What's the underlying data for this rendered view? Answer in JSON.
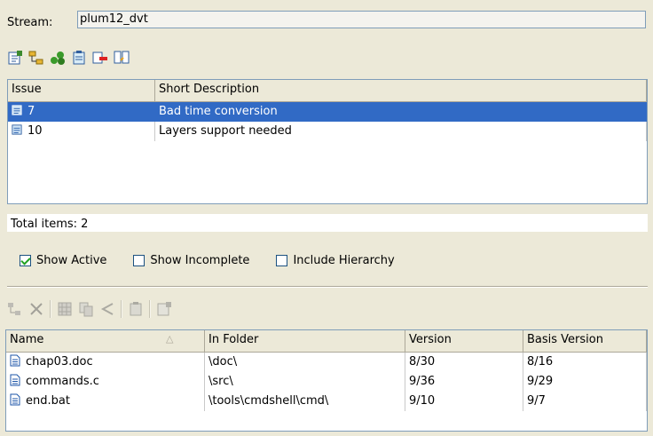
{
  "stream": {
    "label": "Stream:",
    "value": "plum12_dvt"
  },
  "issues": {
    "columns": [
      "Issue",
      "Short Description"
    ],
    "rows": [
      {
        "issue": "7",
        "description": "Bad time conversion",
        "selected": true
      },
      {
        "issue": "10",
        "description": "Layers support needed",
        "selected": false
      }
    ],
    "total_label": "Total items: 2"
  },
  "filters": {
    "show_active": {
      "label": "Show Active",
      "checked": true
    },
    "show_incomplete": {
      "label": "Show Incomplete",
      "checked": false
    },
    "include_hierarchy": {
      "label": "Include Hierarchy",
      "checked": false
    }
  },
  "files": {
    "columns": [
      "Name",
      "In Folder",
      "Version",
      "Basis Version"
    ],
    "sort_indicator": "△",
    "rows": [
      {
        "name": "chap03.doc",
        "folder": "\\doc\\",
        "version": "8/30",
        "basis": "8/16"
      },
      {
        "name": "commands.c",
        "folder": "\\src\\",
        "version": "9/36",
        "basis": "9/29"
      },
      {
        "name": "end.bat",
        "folder": "\\tools\\cmdshell\\cmd\\",
        "version": "9/10",
        "basis": "9/7"
      }
    ]
  },
  "colors": {
    "selection": "#316ac5",
    "window_bg": "#ece9d8",
    "border": "#7f9db9"
  }
}
